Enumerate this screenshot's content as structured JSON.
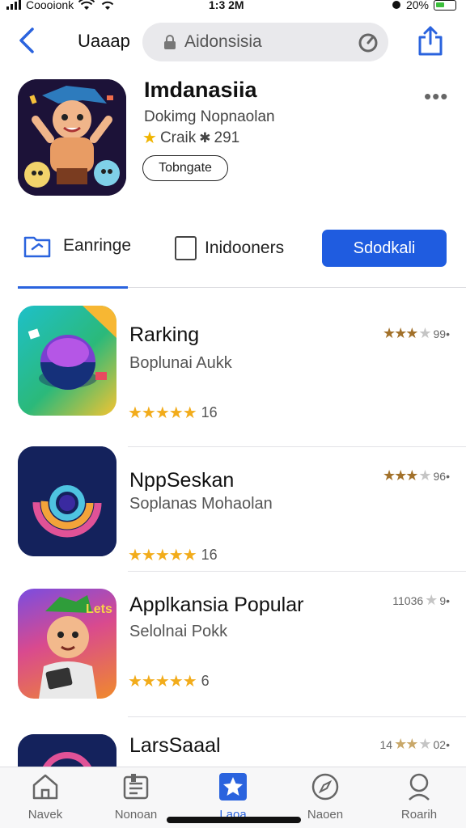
{
  "status": {
    "carrier": "Coooionk",
    "time": "1:3 2M",
    "battery": "20%"
  },
  "nav": {
    "back_label": "Uaaap",
    "search_value": "Aidonsisia",
    "search_placeholder": ""
  },
  "app": {
    "title": "Imdanasiia",
    "subtitle": "Dokimg Nopnaolan",
    "rating_text": "Craik",
    "rating_value": "291",
    "get_label": "Tobngate"
  },
  "tabs": [
    {
      "label": "Eanringe",
      "icon": "folder-icon"
    },
    {
      "label": "Inidooners",
      "icon": "checkbox-icon"
    },
    {
      "label": "Sdodkali",
      "active": true
    }
  ],
  "list": [
    {
      "name": "Rarking",
      "subtitle": "Boplunai Aukk",
      "stars": "★★★★★",
      "count": "16",
      "meta_count": "99•"
    },
    {
      "name": "NppSeskan",
      "subtitle": "Soplanas Mohaolan",
      "stars": "★★★★★",
      "count": "16",
      "meta_count": "96•"
    },
    {
      "name": "Applkansia Popular",
      "subtitle": "Selolnai Pokk",
      "stars": "★★★★★",
      "count": "6",
      "meta_prefix": "11036",
      "meta_count": "9•"
    },
    {
      "name": "LarsSaaal",
      "subtitle": "",
      "stars": "",
      "count": "",
      "meta_prefix": "14",
      "meta_count": "02•"
    }
  ],
  "tabbar": [
    {
      "label": "Navek",
      "icon": "home-icon"
    },
    {
      "label": "Nonoan",
      "icon": "news-icon"
    },
    {
      "label": "Laoa",
      "icon": "star-icon",
      "active": true
    },
    {
      "label": "Naoen",
      "icon": "compass-icon"
    },
    {
      "label": "Roarih",
      "icon": "search-icon"
    }
  ],
  "colors": {
    "accent": "#1f5ce0",
    "star": "#f2ac1b",
    "divider": "#dcdce0"
  }
}
